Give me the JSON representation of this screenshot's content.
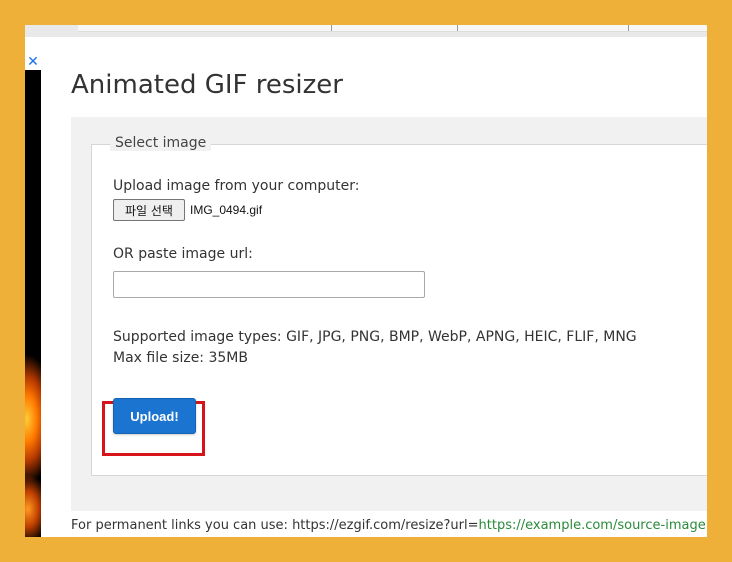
{
  "ad": {
    "close_glyph": "✕"
  },
  "page": {
    "title": "Animated GIF resizer"
  },
  "form": {
    "legend": "Select image",
    "upload_label": "Upload image from your computer:",
    "file_button_label": "파일 선택",
    "file_name": "IMG_0494.gif",
    "url_label": "OR paste image url:",
    "url_value": "",
    "url_placeholder": "",
    "supported_types": "Supported image types: GIF, JPG, PNG, BMP, WebP, APNG, HEIC, FLIF, MNG",
    "max_size": "Max file size: 35MB",
    "upload_button_label": "Upload!"
  },
  "footer": {
    "text": "For permanent links you can use: https://ezgif.com/resize?url=",
    "link": "https://example.com/source-image.gif"
  },
  "colors": {
    "frame": "#efb03a",
    "primary_button": "#1a74d0",
    "highlight": "#d8141b",
    "link": "#2a8a3a"
  }
}
